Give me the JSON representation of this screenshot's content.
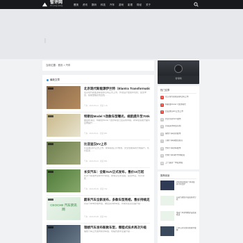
{
  "site": {
    "name": "智评网",
    "sub": "zhi ping wang"
  },
  "nav": [
    "首页",
    "资讯",
    "数码",
    "科技",
    "汽车",
    "游戏",
    "影视",
    "财经",
    "关于"
  ],
  "breadcrumb": "当前位置：首页 > 汽车",
  "section": {
    "title": "最新文章"
  },
  "posts": [
    {
      "title": "北京现代新能源伊兰特（Elantra Transformation）",
      "excerpt": "北京现代新能源车型伊兰特正式上市，外观设计更加年轻化，配置丰富，续航里程表现出色……",
      "meta": "汽车 · 2023-05-12 · 阅读 1.2k",
      "colors": [
        "#8a6a4a",
        "#b58b5f"
      ]
    },
    {
      "title": "特斯拉Model Y改款车型曝光，续航提升至700km",
      "excerpt": "据最新消息，特斯拉Model Y改款车型已经完成申报，新车在续航方面有显著提升……",
      "meta": "汽车 · 2023-05-11 · 阅读 986",
      "colors": [
        "#c9b98a",
        "#e8e3cf"
      ]
    },
    {
      "title": "比亚迪汉EV上市",
      "excerpt": "比亚迪汉EV正式上市，新车搭载刀片电池，安全性能得到大幅提升，售价区间……",
      "meta": "汽车 · 2023-05-10 · 阅读 854",
      "colors": [
        "#6b7d4a",
        "#9fa87a"
      ]
    },
    {
      "title": "长安汽车：全新SUV正式发布，售价10万起",
      "excerpt": "长安汽车发布全新SUV车型，新车定位紧凑级，配置丰富，售价亲民……",
      "meta": "汽车 · 2023-05-09 · 阅读 732",
      "colors": [
        "#4f7a3a",
        "#86a86a"
      ]
    },
    {
      "title": "蔚来汽车全新发布，多款车型亮相，售价持续走高",
      "excerpt": "蔚来汽车举办发布会，推出多款新车型，智能化配置全面升级……",
      "meta": "汽车 · 2023-05-08 · 阅读 651",
      "colors": [
        "#e9f3ea",
        "#d6ead8"
      ],
      "logo_text": "CEOCHE 汽车资讯网"
    },
    {
      "title": "理想汽车发布新款车型，增程式技术再次升级",
      "excerpt": "理想汽车正式发布新款车型，增程式技术全面升级……",
      "meta": "汽车 · 2023-05-07 · 阅读 540",
      "colors": [
        "#3b4a5a",
        "#6c7c8c"
      ]
    }
  ],
  "profile": {
    "name": "智评网"
  },
  "hot": {
    "title": "热门文章",
    "items": [
      "北京现代新能源伊兰特上市",
      "特斯拉Model Y改款曝光",
      "比亚迪汉EV正式上市",
      "长安全新SUV发布",
      "蔚来多款车型亮相",
      "理想汽车新款发布",
      "小鹏汽车销量创新高",
      "吉利汽车新车发布",
      "长城汽车海外市场拓展",
      "上汽集团一季度财报"
    ]
  },
  "recommend": {
    "title": "推荐阅读",
    "items": [
      {
        "text": "2023年新能源汽车销量排行榜出炉",
        "color": "#2f3a55"
      },
      {
        "text": "自动驾驶技术发展现状分析",
        "color": "#e9f3ea"
      },
      {
        "text": "电动汽车充电桩建设加速推进",
        "color": "#e9f3ea"
      },
      {
        "text": "汽车芯片短缺问题逐步缓解",
        "color": "#3a4a5c"
      }
    ]
  }
}
